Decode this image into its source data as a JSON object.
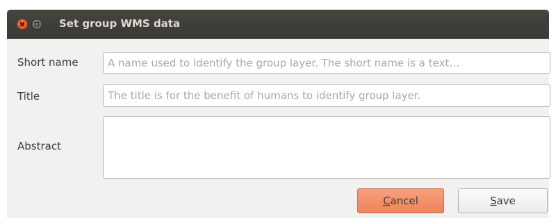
{
  "window": {
    "title": "Set group WMS data"
  },
  "form": {
    "short_name": {
      "label": "Short name",
      "placeholder": "A name used to identify the group layer. The short name is a text…",
      "value": ""
    },
    "title": {
      "label": "Title",
      "placeholder": "The title is for the benefit of humans to identify group layer.",
      "value": ""
    },
    "abstract": {
      "label": "Abstract",
      "value": ""
    }
  },
  "buttons": {
    "cancel": {
      "mnemonic": "C",
      "rest": "ancel"
    },
    "save": {
      "mnemonic": "S",
      "rest": "ave"
    }
  },
  "colors": {
    "titlebar": "#3e3d39",
    "title_text": "#dfdbd2",
    "close_button": "#e95420",
    "dialog_background": "#f2f1f0",
    "cancel_button": "#f29168",
    "placeholder_text": "#a9a7a3"
  },
  "icons": {
    "close": "close-icon",
    "minimize": "minimize-icon"
  }
}
